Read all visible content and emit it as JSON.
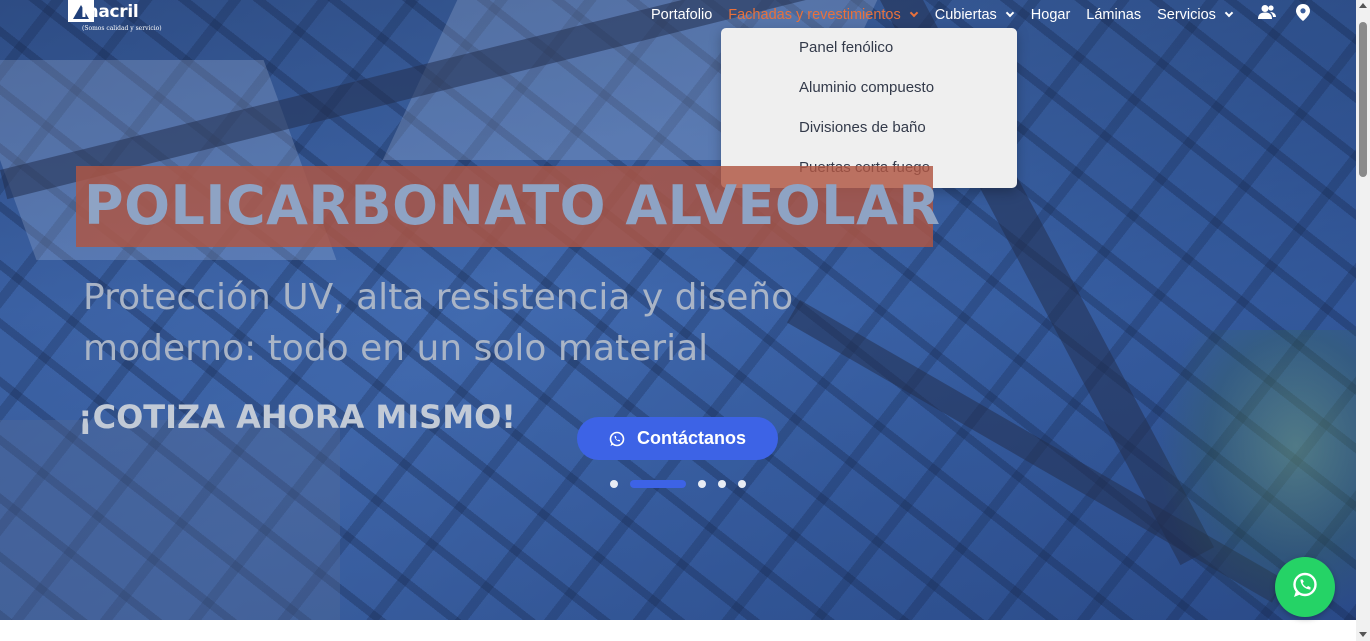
{
  "brand": {
    "name": "inacril",
    "tagline": "(Somos calidad y servicio)"
  },
  "nav": {
    "items": [
      {
        "label": "Portafolio"
      },
      {
        "label": "Fachadas y revestimientos"
      },
      {
        "label": "Cubiertas"
      },
      {
        "label": "Hogar"
      },
      {
        "label": "Láminas"
      },
      {
        "label": "Servicios"
      }
    ],
    "icons": [
      "users-icon",
      "location-pin-icon"
    ]
  },
  "dropdown": {
    "items": [
      "Panel fenólico",
      "Aluminio compuesto",
      "Divisiones de baño",
      "Puertas corta fuego"
    ]
  },
  "hero": {
    "headline": "POLICARBONATO ALVEOLAR",
    "subtitle": "Protección UV, alta resistencia y diseño moderno: todo en un solo material",
    "cta": "¡COTIZA AHORA MISMO!",
    "button_label": "Contáctanos",
    "slides_total": 5,
    "active_slide": 2
  },
  "colors": {
    "accent": "#e8713c",
    "button": "#3d63e6",
    "headline_bg": "#b05642",
    "whatsapp": "#25d366"
  }
}
